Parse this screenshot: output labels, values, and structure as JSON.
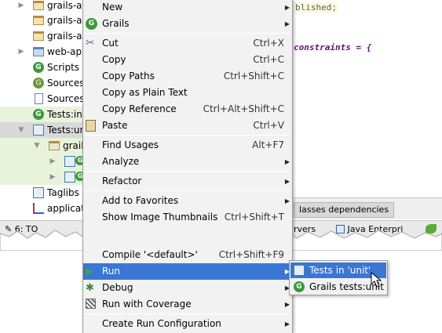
{
  "project_tree": [
    {
      "label": "grails-ap",
      "icon": "folder-icon",
      "expand": "collapsed"
    },
    {
      "label": "grails-ap",
      "icon": "folder-icon",
      "expand": "none"
    },
    {
      "label": "grails-ap",
      "icon": "folder-icon",
      "expand": "none"
    },
    {
      "label": "web-app",
      "icon": "web-folder-icon",
      "expand": "collapsed"
    },
    {
      "label": "Scripts",
      "icon": "grails-icon",
      "expand": "none"
    },
    {
      "label": "Sources:",
      "icon": "sources-icon",
      "expand": "none"
    },
    {
      "label": "Sources:",
      "icon": "document-icon",
      "expand": "none"
    },
    {
      "label": "Tests:int",
      "icon": "grails-icon",
      "expand": "none"
    },
    {
      "label": "Tests:uni",
      "icon": "tests-icon",
      "expand": "expanded"
    },
    {
      "label": "grails",
      "icon": "package-icon",
      "expand": "expanded"
    },
    {
      "label": "",
      "icon": "class-icon",
      "expand": "collapsed"
    },
    {
      "label": "",
      "icon": "class-icon",
      "expand": "collapsed"
    },
    {
      "label": "Taglibs",
      "icon": "taglib-icon",
      "expand": "none"
    },
    {
      "label": "applicati",
      "icon": "chart-icon",
      "expand": "none"
    }
  ],
  "editor": {
    "line1": "blished;",
    "line2": "constraints = {",
    "tab_label": "lasses dependencies"
  },
  "toolstrip": {
    "todo": "6: TO",
    "servers": "rvers",
    "java_enterprise": "Java Enterpri"
  },
  "menu": {
    "items": [
      {
        "label": "New",
        "shortcut": "",
        "submenu": true,
        "icon": ""
      },
      {
        "label": "Grails",
        "shortcut": "",
        "submenu": true,
        "icon": "grails-icon"
      },
      {
        "label": "Cut",
        "shortcut": "Ctrl+X",
        "submenu": false,
        "icon": "scissors-icon"
      },
      {
        "label": "Copy",
        "shortcut": "Ctrl+C",
        "submenu": false,
        "icon": "copy-icon"
      },
      {
        "label": "Copy Paths",
        "shortcut": "Ctrl+Shift+C",
        "submenu": false,
        "icon": ""
      },
      {
        "label": "Copy as Plain Text",
        "shortcut": "",
        "submenu": false,
        "icon": ""
      },
      {
        "label": "Copy Reference",
        "shortcut": "Ctrl+Alt+Shift+C",
        "submenu": false,
        "icon": ""
      },
      {
        "label": "Paste",
        "shortcut": "Ctrl+V",
        "submenu": false,
        "icon": "paste-icon"
      },
      {
        "label": "Find Usages",
        "shortcut": "Alt+F7",
        "submenu": false,
        "icon": ""
      },
      {
        "label": "Analyze",
        "shortcut": "",
        "submenu": true,
        "icon": ""
      },
      {
        "label": "Refactor",
        "shortcut": "",
        "submenu": true,
        "icon": ""
      },
      {
        "label": "Add to Favorites",
        "shortcut": "",
        "submenu": true,
        "icon": ""
      },
      {
        "label": "Show Image Thumbnails",
        "shortcut": "Ctrl+Shift+T",
        "submenu": false,
        "icon": ""
      },
      {
        "label": "Compile '<default>'",
        "shortcut": "Ctrl+Shift+F9",
        "submenu": false,
        "icon": ""
      },
      {
        "label": "Run",
        "shortcut": "",
        "submenu": true,
        "icon": "run-icon",
        "selected": true
      },
      {
        "label": "Debug",
        "shortcut": "",
        "submenu": true,
        "icon": "debug-icon"
      },
      {
        "label": "Run with Coverage",
        "shortcut": "",
        "submenu": true,
        "icon": "coverage-icon"
      },
      {
        "label": "Create Run Configuration",
        "shortcut": "",
        "submenu": true,
        "icon": ""
      }
    ]
  },
  "submenu": {
    "items": [
      {
        "label": "Tests in 'unit'",
        "icon": "tests-icon",
        "selected": true
      },
      {
        "label": "Grails tests:unit",
        "icon": "grails-icon",
        "selected": false
      }
    ]
  },
  "colors": {
    "selection": "#3a76d4",
    "menu_bg": "#f2f2f2",
    "tree_highlight_green": "#e8f3dc",
    "tree_highlight_gray": "#d9d9d9"
  }
}
